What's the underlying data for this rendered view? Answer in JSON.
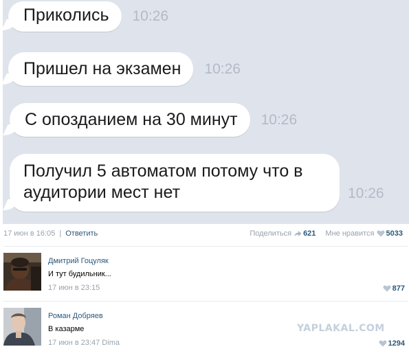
{
  "chat": {
    "messages": [
      {
        "text": "Приколись",
        "time": "10:26"
      },
      {
        "text": "Пришел на экзамен",
        "time": "10:26"
      },
      {
        "text": "С опозданием на 30 минут",
        "time": "10:26"
      },
      {
        "text": "Получил 5 автоматом потому что в аудитории мест нет",
        "time": "10:26"
      }
    ]
  },
  "post": {
    "date": "17 июн в 16:05",
    "separator": "|",
    "reply_label": "Ответить",
    "share_label": "Поделиться",
    "share_count": "621",
    "like_label": "Мне нравится",
    "like_count": "5033"
  },
  "comments": [
    {
      "author": "Дмитрий Гоцуляк",
      "text": "И тут будильник...",
      "date": "17 июн в 23:15",
      "likes": "877"
    },
    {
      "author": "Роман Добряев",
      "text": "В казарме",
      "date": "17 июн в 23:47 Dima",
      "likes": "1294"
    }
  ],
  "watermark": "YAPLAKAL.COM",
  "colors": {
    "chat_bg": "#dfe4ec",
    "link": "#2b587a",
    "muted": "#99a2ad"
  }
}
